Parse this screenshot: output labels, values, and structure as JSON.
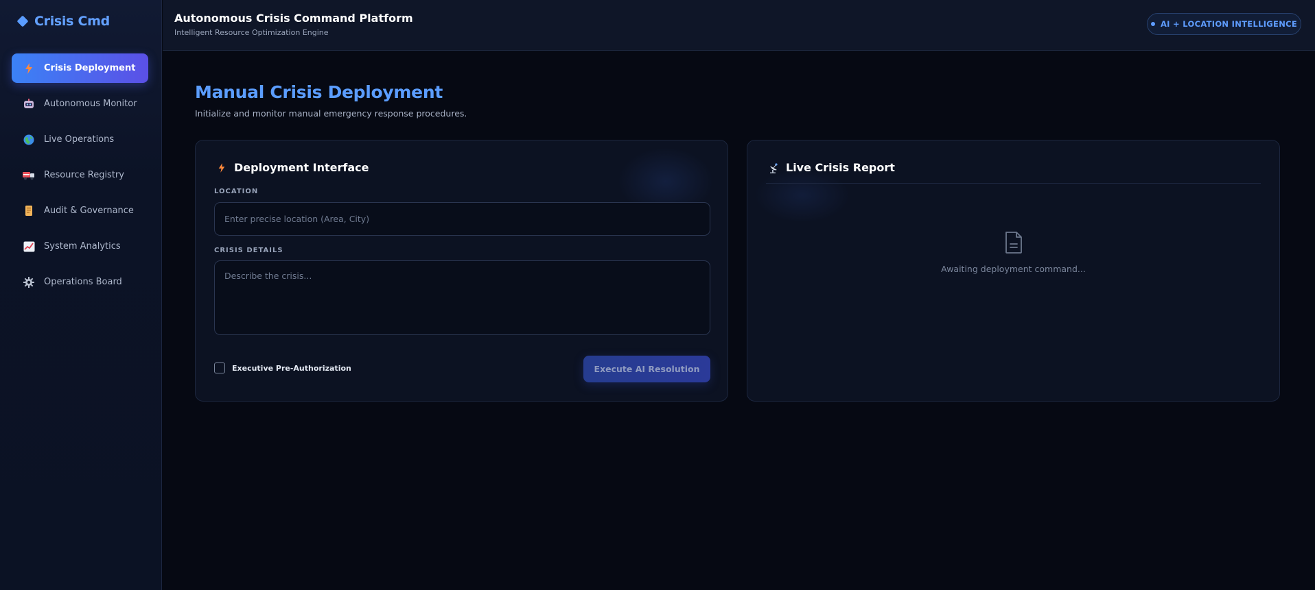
{
  "sidebar": {
    "logo": "Crisis Cmd",
    "items": [
      {
        "label": "Crisis Deployment",
        "icon": "lightning-icon",
        "active": true
      },
      {
        "label": "Autonomous Monitor",
        "icon": "robot-icon",
        "active": false
      },
      {
        "label": "Live Operations",
        "icon": "globe-icon",
        "active": false
      },
      {
        "label": "Resource Registry",
        "icon": "truck-icon",
        "active": false
      },
      {
        "label": "Audit & Governance",
        "icon": "scroll-icon",
        "active": false
      },
      {
        "label": "System Analytics",
        "icon": "chart-icon",
        "active": false
      },
      {
        "label": "Operations Board",
        "icon": "gear-icon",
        "active": false
      }
    ]
  },
  "header": {
    "title": "Autonomous Crisis Command Platform",
    "subtitle": "Intelligent Resource Optimization Engine",
    "badge": "AI + LOCATION INTELLIGENCE"
  },
  "main": {
    "title": "Manual Crisis Deployment",
    "subtitle": "Initialize and monitor manual emergency response procedures."
  },
  "deployment": {
    "title": "Deployment Interface",
    "location_label": "LOCATION",
    "location_placeholder": "Enter precise location (Area, City)",
    "location_value": "",
    "details_label": "CRISIS DETAILS",
    "details_placeholder": "Describe the crisis...",
    "details_value": "",
    "preauth_label": "Executive Pre-Authorization",
    "execute_label": "Execute AI Resolution"
  },
  "report": {
    "title": "Live Crisis Report",
    "empty_text": "Awaiting deployment command..."
  },
  "colors": {
    "accent": "#5b9dff",
    "active_nav_start": "#3b82f6",
    "active_nav_end": "#5b50e6",
    "background": "#060913"
  }
}
